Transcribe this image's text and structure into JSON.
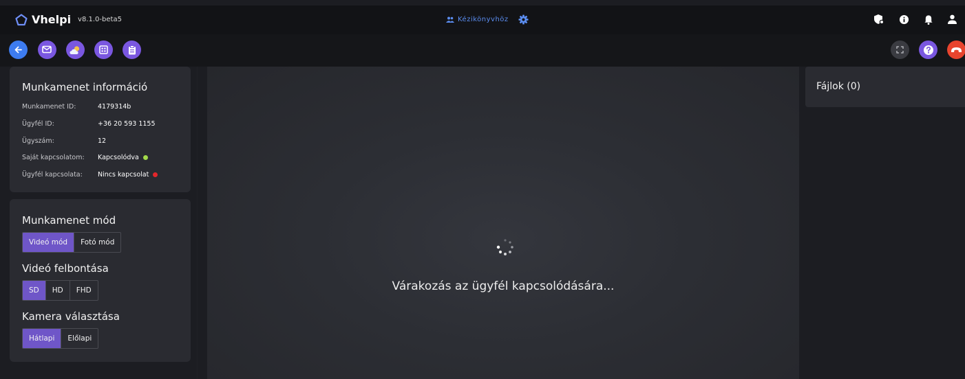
{
  "header": {
    "app_name": "Vhelpi",
    "version": "v8.1.0-beta5",
    "manual_link": "Kézikönyvhöz",
    "icons": [
      "logo-icon",
      "users-icon",
      "gear-icon",
      "shield-icon",
      "info-icon",
      "bell-icon",
      "user-icon"
    ]
  },
  "actions": {
    "left": [
      "back-icon",
      "mail-icon",
      "weather-icon",
      "calculator-icon",
      "clipboard-icon"
    ],
    "right": [
      "fullscreen-icon",
      "help-icon",
      "hangup-icon"
    ]
  },
  "session_info": {
    "title": "Munkamenet információ",
    "rows": [
      {
        "key": "Munkamenet ID:",
        "value": "4179314b"
      },
      {
        "key": "Ügyfél ID:",
        "value": "+36 20 593 1155"
      },
      {
        "key": "Ügyszám:",
        "value": "12"
      },
      {
        "key": "Saját kapcsolatom:",
        "value": "Kapcsolódva",
        "status": "#a3d94a"
      },
      {
        "key": "Ügyfél kapcsolata:",
        "value": "Nincs kapcsolat",
        "status": "#e3262b"
      }
    ]
  },
  "session_mode": {
    "title": "Munkamenet mód",
    "mode_options": [
      "Videó mód",
      "Fotó mód"
    ],
    "mode_selected": "Videó mód",
    "resolution_title": "Videó felbontása",
    "resolution_options": [
      "SD",
      "HD",
      "FHD"
    ],
    "resolution_selected": "SD",
    "camera_title": "Kamera választása",
    "camera_options": [
      "Hátlapi",
      "Előlapi"
    ],
    "camera_selected": "Hátlapi"
  },
  "stage": {
    "waiting_text": "Várakozás az ügyfél kapcsolódására..."
  },
  "files": {
    "title": "Fájlok (0)"
  },
  "colors": {
    "accent": "#6f56c8",
    "link_blue": "#5b8df0",
    "back_blue": "#3d7cf0",
    "hangup_red": "#e8442e",
    "connected": "#a3d94a",
    "disconnected": "#e3262b"
  }
}
